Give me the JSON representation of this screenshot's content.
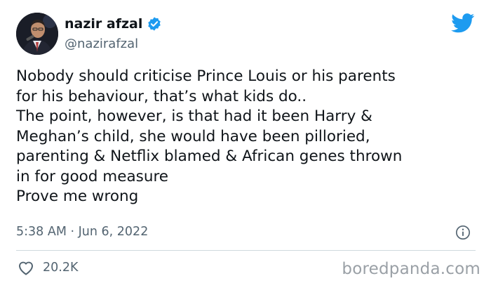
{
  "author": {
    "name": "nazir afzal",
    "handle": "@nazirafzal",
    "verified": true
  },
  "tweet": {
    "lines": [
      "Nobody should criticise Prince Louis or his parents",
      "for his behaviour, that’s what kids do..",
      "The point, however, is that had it been Harry &",
      "Meghan’s child, she would have been pilloried,",
      "parenting & Netflix blamed & African genes thrown",
      "in for good measure",
      "Prove me wrong"
    ],
    "timestamp": "5:38 AM · Jun 6, 2022"
  },
  "engagement": {
    "likes": "20.2K"
  },
  "watermark": "boredpanda.com",
  "icons": {
    "verified": "verified-badge-icon",
    "brand": "twitter-bird-icon",
    "info": "info-icon",
    "like": "heart-icon"
  },
  "colors": {
    "text": "#0f1419",
    "secondary": "#536471",
    "twitter_blue": "#1d9bf0",
    "divider": "#cfd9de"
  }
}
